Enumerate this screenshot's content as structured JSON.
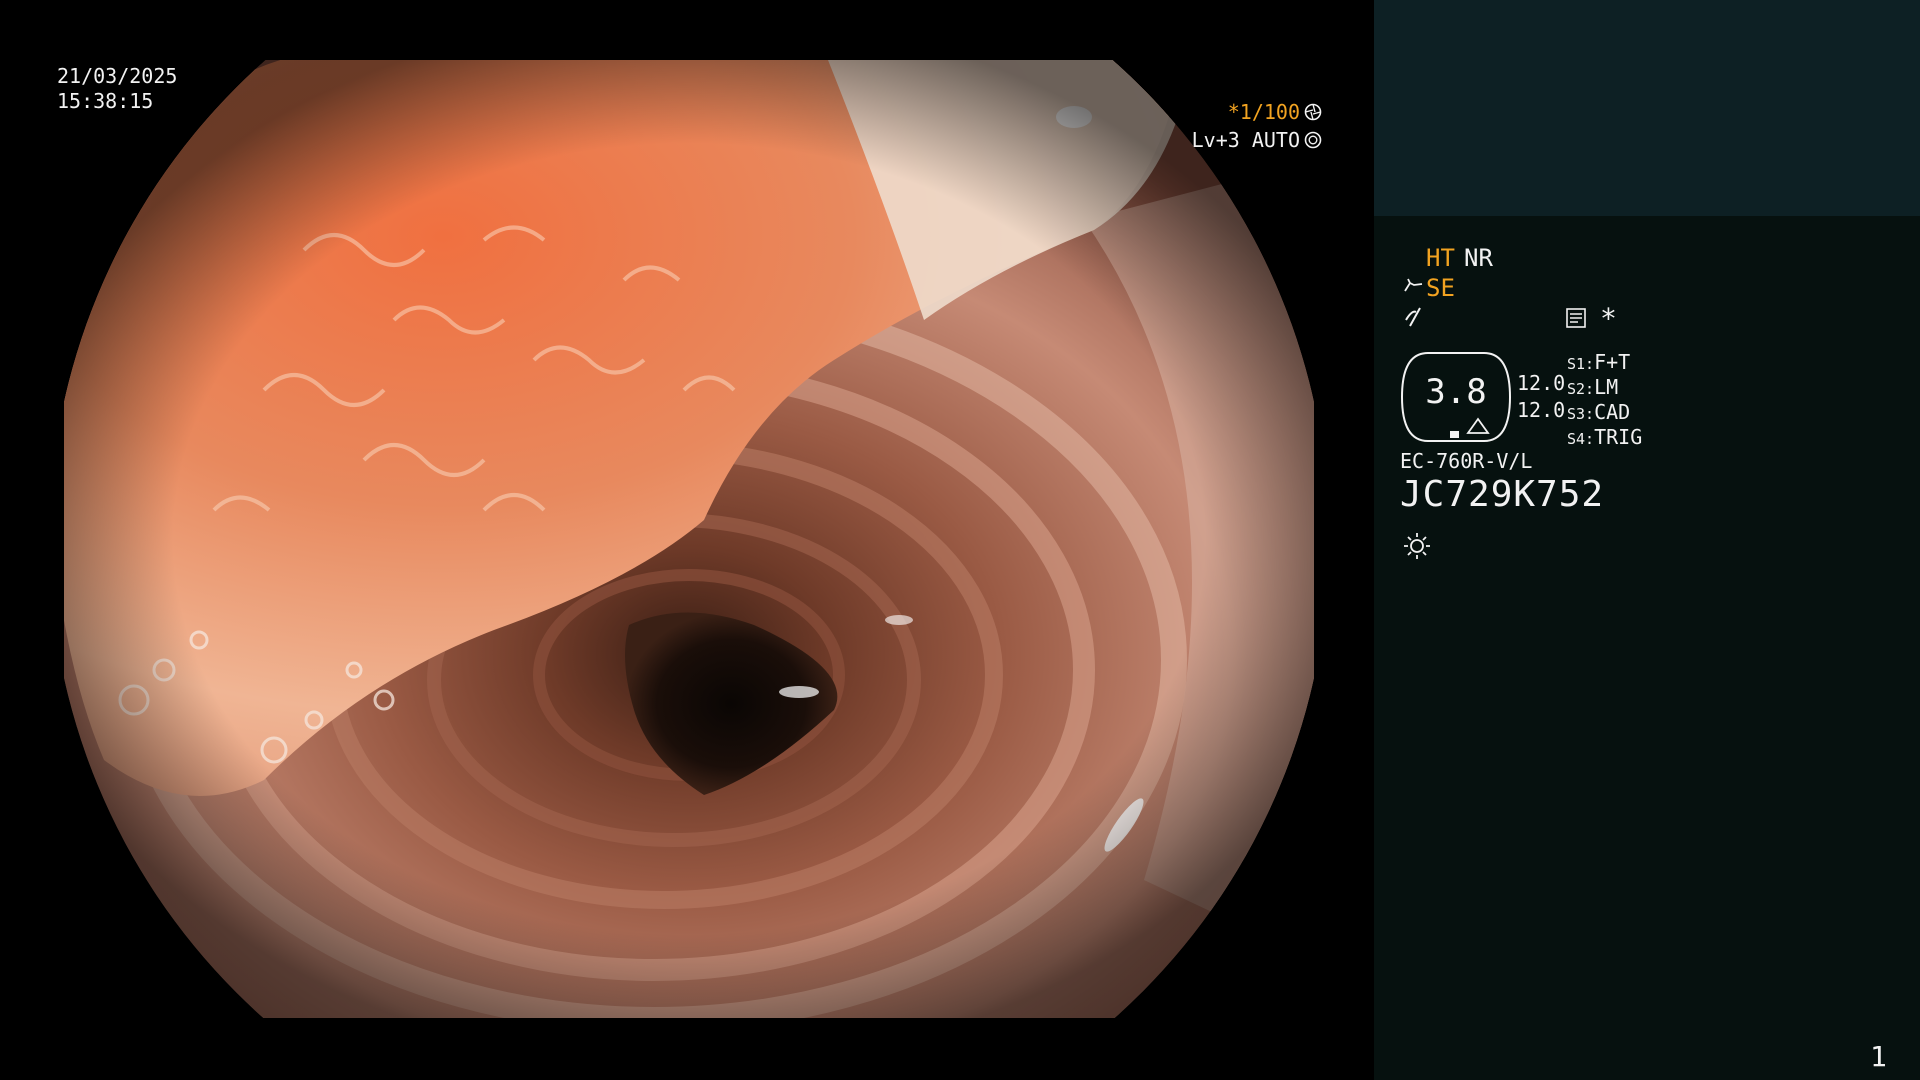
{
  "overlay": {
    "date": "21/03/2025",
    "time": "15:38:15",
    "shutter": "*1/100",
    "shutter_icon": "aperture-icon",
    "level": "Lv+3 AUTO",
    "level_icon": "iris-icon"
  },
  "panel": {
    "ht": "HT",
    "nr": "NR",
    "se": "SE",
    "se_icon": "hand-icon",
    "flash_icon": "lightning-icon",
    "memo_icon": "memo-icon",
    "star": "*",
    "scale_main": "3.8",
    "scale_a": "12.0",
    "scale_b": "12.0",
    "switches": [
      {
        "key": "S1:",
        "value": "F+T"
      },
      {
        "key": "S2:",
        "value": "LM"
      },
      {
        "key": "S3:",
        "value": "CAD"
      },
      {
        "key": "S4:",
        "value": "TRIG"
      }
    ],
    "model": "EC-760R-V/L",
    "serial": "JC729K752",
    "light_icon": "sun-icon",
    "page": "1"
  },
  "colors": {
    "accent_orange": "#f2a321",
    "panel_bg": "#06110f",
    "panel_top": "#0d2024",
    "text": "#f2f2f2"
  }
}
